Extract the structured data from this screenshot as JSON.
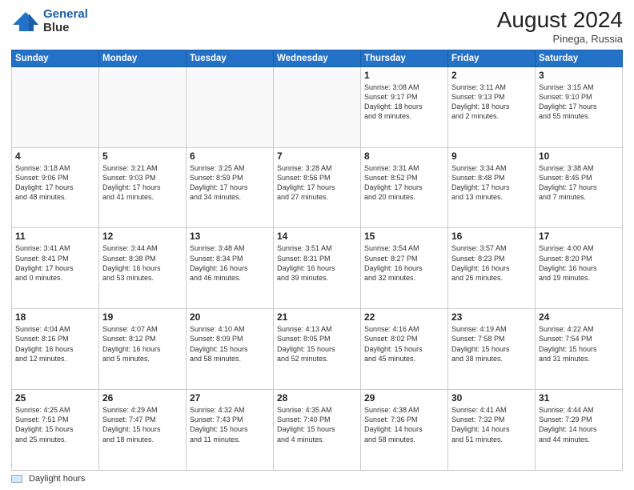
{
  "header": {
    "logo_line1": "General",
    "logo_line2": "Blue",
    "month_year": "August 2024",
    "location": "Pinega, Russia"
  },
  "footer": {
    "legend_label": "Daylight hours"
  },
  "weekdays": [
    "Sunday",
    "Monday",
    "Tuesday",
    "Wednesday",
    "Thursday",
    "Friday",
    "Saturday"
  ],
  "weeks": [
    [
      {
        "day": "",
        "info": ""
      },
      {
        "day": "",
        "info": ""
      },
      {
        "day": "",
        "info": ""
      },
      {
        "day": "",
        "info": ""
      },
      {
        "day": "1",
        "info": "Sunrise: 3:08 AM\nSunset: 9:17 PM\nDaylight: 18 hours\nand 8 minutes."
      },
      {
        "day": "2",
        "info": "Sunrise: 3:11 AM\nSunset: 9:13 PM\nDaylight: 18 hours\nand 2 minutes."
      },
      {
        "day": "3",
        "info": "Sunrise: 3:15 AM\nSunset: 9:10 PM\nDaylight: 17 hours\nand 55 minutes."
      }
    ],
    [
      {
        "day": "4",
        "info": "Sunrise: 3:18 AM\nSunset: 9:06 PM\nDaylight: 17 hours\nand 48 minutes."
      },
      {
        "day": "5",
        "info": "Sunrise: 3:21 AM\nSunset: 9:03 PM\nDaylight: 17 hours\nand 41 minutes."
      },
      {
        "day": "6",
        "info": "Sunrise: 3:25 AM\nSunset: 8:59 PM\nDaylight: 17 hours\nand 34 minutes."
      },
      {
        "day": "7",
        "info": "Sunrise: 3:28 AM\nSunset: 8:56 PM\nDaylight: 17 hours\nand 27 minutes."
      },
      {
        "day": "8",
        "info": "Sunrise: 3:31 AM\nSunset: 8:52 PM\nDaylight: 17 hours\nand 20 minutes."
      },
      {
        "day": "9",
        "info": "Sunrise: 3:34 AM\nSunset: 8:48 PM\nDaylight: 17 hours\nand 13 minutes."
      },
      {
        "day": "10",
        "info": "Sunrise: 3:38 AM\nSunset: 8:45 PM\nDaylight: 17 hours\nand 7 minutes."
      }
    ],
    [
      {
        "day": "11",
        "info": "Sunrise: 3:41 AM\nSunset: 8:41 PM\nDaylight: 17 hours\nand 0 minutes."
      },
      {
        "day": "12",
        "info": "Sunrise: 3:44 AM\nSunset: 8:38 PM\nDaylight: 16 hours\nand 53 minutes."
      },
      {
        "day": "13",
        "info": "Sunrise: 3:48 AM\nSunset: 8:34 PM\nDaylight: 16 hours\nand 46 minutes."
      },
      {
        "day": "14",
        "info": "Sunrise: 3:51 AM\nSunset: 8:31 PM\nDaylight: 16 hours\nand 39 minutes."
      },
      {
        "day": "15",
        "info": "Sunrise: 3:54 AM\nSunset: 8:27 PM\nDaylight: 16 hours\nand 32 minutes."
      },
      {
        "day": "16",
        "info": "Sunrise: 3:57 AM\nSunset: 8:23 PM\nDaylight: 16 hours\nand 26 minutes."
      },
      {
        "day": "17",
        "info": "Sunrise: 4:00 AM\nSunset: 8:20 PM\nDaylight: 16 hours\nand 19 minutes."
      }
    ],
    [
      {
        "day": "18",
        "info": "Sunrise: 4:04 AM\nSunset: 8:16 PM\nDaylight: 16 hours\nand 12 minutes."
      },
      {
        "day": "19",
        "info": "Sunrise: 4:07 AM\nSunset: 8:12 PM\nDaylight: 16 hours\nand 5 minutes."
      },
      {
        "day": "20",
        "info": "Sunrise: 4:10 AM\nSunset: 8:09 PM\nDaylight: 15 hours\nand 58 minutes."
      },
      {
        "day": "21",
        "info": "Sunrise: 4:13 AM\nSunset: 8:05 PM\nDaylight: 15 hours\nand 52 minutes."
      },
      {
        "day": "22",
        "info": "Sunrise: 4:16 AM\nSunset: 8:02 PM\nDaylight: 15 hours\nand 45 minutes."
      },
      {
        "day": "23",
        "info": "Sunrise: 4:19 AM\nSunset: 7:58 PM\nDaylight: 15 hours\nand 38 minutes."
      },
      {
        "day": "24",
        "info": "Sunrise: 4:22 AM\nSunset: 7:54 PM\nDaylight: 15 hours\nand 31 minutes."
      }
    ],
    [
      {
        "day": "25",
        "info": "Sunrise: 4:25 AM\nSunset: 7:51 PM\nDaylight: 15 hours\nand 25 minutes."
      },
      {
        "day": "26",
        "info": "Sunrise: 4:29 AM\nSunset: 7:47 PM\nDaylight: 15 hours\nand 18 minutes."
      },
      {
        "day": "27",
        "info": "Sunrise: 4:32 AM\nSunset: 7:43 PM\nDaylight: 15 hours\nand 11 minutes."
      },
      {
        "day": "28",
        "info": "Sunrise: 4:35 AM\nSunset: 7:40 PM\nDaylight: 15 hours\nand 4 minutes."
      },
      {
        "day": "29",
        "info": "Sunrise: 4:38 AM\nSunset: 7:36 PM\nDaylight: 14 hours\nand 58 minutes."
      },
      {
        "day": "30",
        "info": "Sunrise: 4:41 AM\nSunset: 7:32 PM\nDaylight: 14 hours\nand 51 minutes."
      },
      {
        "day": "31",
        "info": "Sunrise: 4:44 AM\nSunset: 7:29 PM\nDaylight: 14 hours\nand 44 minutes."
      }
    ]
  ]
}
